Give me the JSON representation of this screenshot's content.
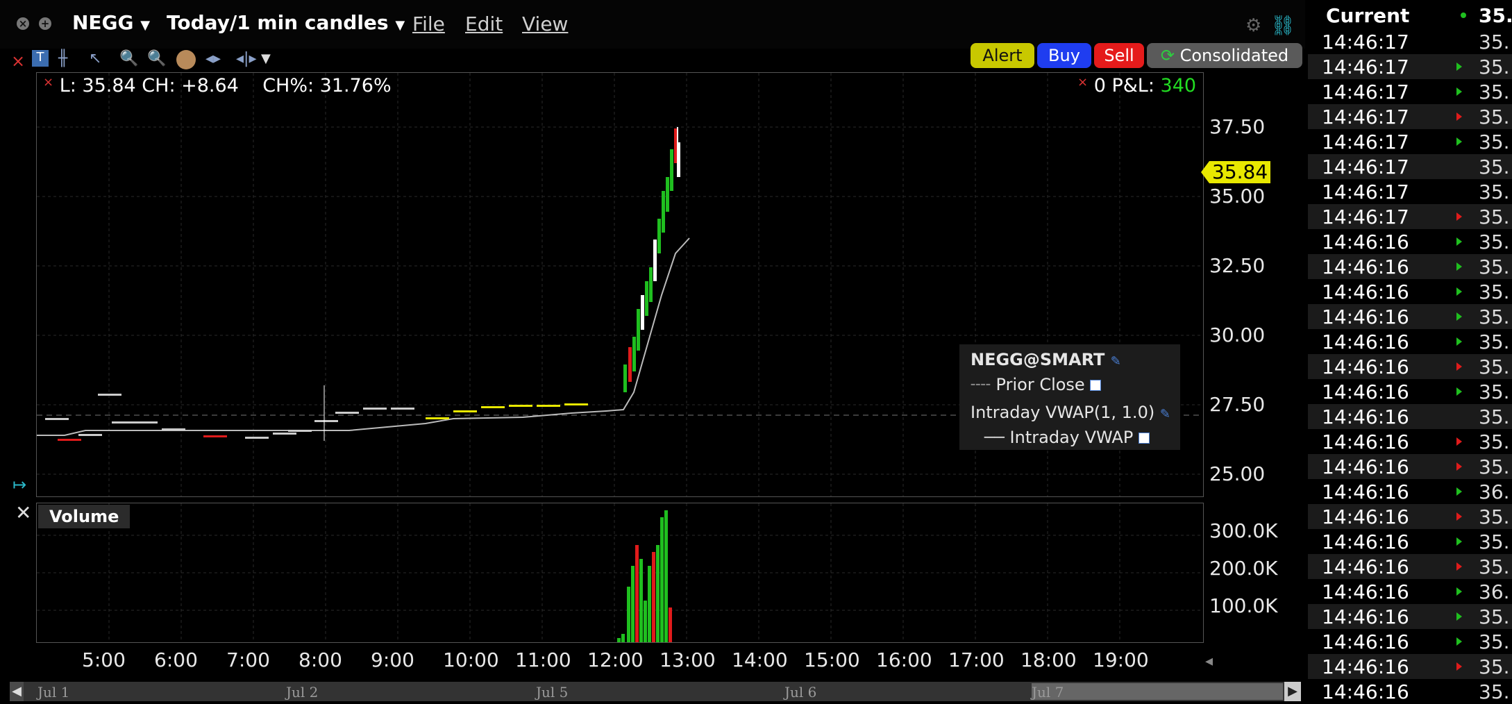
{
  "topbar": {
    "ticker": "NEGG",
    "timeframe": "Today/1 min candles",
    "menu": [
      "File",
      "Edit",
      "View"
    ]
  },
  "actions": {
    "alert": "Alert",
    "buy": "Buy",
    "sell": "Sell",
    "consolidated": "Consolidated"
  },
  "stats": {
    "text": "L: 35.84 CH: +8.64    CH%: 31.76%",
    "pnl_label": "0 P&L:",
    "pnl_value": "340"
  },
  "price_axis": {
    "ticks": [
      "37.50",
      "35.00",
      "32.50",
      "30.00",
      "27.50",
      "25.00"
    ],
    "current": "35.84"
  },
  "volume_pane": {
    "title": "Volume",
    "ticks": [
      "300.0K",
      "200.0K",
      "100.0K"
    ]
  },
  "time_axis": [
    "5:00",
    "6:00",
    "7:00",
    "8:00",
    "9:00",
    "10:00",
    "11:00",
    "12:00",
    "13:00",
    "14:00",
    "15:00",
    "16:00",
    "17:00",
    "18:00",
    "19:00"
  ],
  "date_axis": [
    "Jul 1",
    "Jul 2",
    "Jul 5",
    "Jul 6",
    "Jul 7"
  ],
  "legend": {
    "title": "NEGG@SMART",
    "prior_close": "Prior Close",
    "vwap_title": "Intraday VWAP(1, 1.0)",
    "vwap_line": "Intraday VWAP"
  },
  "colors": {
    "up": "#1fbf1f",
    "down": "#e01b1b",
    "flat": "#e8e800",
    "alert_bg": "#c8c800",
    "buy_bg": "#1f3df0",
    "sell_bg": "#e51b1b",
    "pnl": "#22dd22"
  },
  "time_sales": {
    "header": "Current",
    "header_price": "35.",
    "rows": [
      {
        "time": "14:46:17",
        "dir": "none",
        "price": "35."
      },
      {
        "time": "14:46:17",
        "dir": "up",
        "price": "35."
      },
      {
        "time": "14:46:17",
        "dir": "up",
        "price": "35."
      },
      {
        "time": "14:46:17",
        "dir": "down",
        "price": "35."
      },
      {
        "time": "14:46:17",
        "dir": "up",
        "price": "35."
      },
      {
        "time": "14:46:17",
        "dir": "none",
        "price": "35."
      },
      {
        "time": "14:46:17",
        "dir": "none",
        "price": "35."
      },
      {
        "time": "14:46:17",
        "dir": "down",
        "price": "35."
      },
      {
        "time": "14:46:16",
        "dir": "up",
        "price": "35."
      },
      {
        "time": "14:46:16",
        "dir": "up",
        "price": "35."
      },
      {
        "time": "14:46:16",
        "dir": "up",
        "price": "35."
      },
      {
        "time": "14:46:16",
        "dir": "up",
        "price": "35."
      },
      {
        "time": "14:46:16",
        "dir": "up",
        "price": "35."
      },
      {
        "time": "14:46:16",
        "dir": "down",
        "price": "35."
      },
      {
        "time": "14:46:16",
        "dir": "up",
        "price": "35."
      },
      {
        "time": "14:46:16",
        "dir": "none",
        "price": "35."
      },
      {
        "time": "14:46:16",
        "dir": "down",
        "price": "35."
      },
      {
        "time": "14:46:16",
        "dir": "down",
        "price": "35."
      },
      {
        "time": "14:46:16",
        "dir": "up",
        "price": "36."
      },
      {
        "time": "14:46:16",
        "dir": "down",
        "price": "35."
      },
      {
        "time": "14:46:16",
        "dir": "up",
        "price": "35."
      },
      {
        "time": "14:46:16",
        "dir": "down",
        "price": "35."
      },
      {
        "time": "14:46:16",
        "dir": "up",
        "price": "36."
      },
      {
        "time": "14:46:16",
        "dir": "up",
        "price": "35."
      },
      {
        "time": "14:46:16",
        "dir": "up",
        "price": "35."
      },
      {
        "time": "14:46:16",
        "dir": "down",
        "price": "35."
      },
      {
        "time": "14:46:16",
        "dir": "none",
        "price": "35."
      }
    ]
  }
}
